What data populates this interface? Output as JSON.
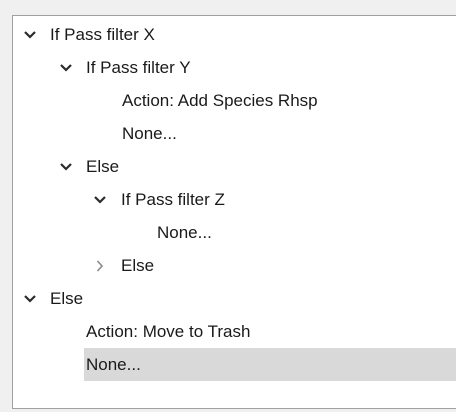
{
  "tree": {
    "nodes": [
      {
        "label": "If Pass filter X",
        "expanded": true,
        "chevron": "chevron-down-icon"
      },
      {
        "label": "If Pass filter Y",
        "expanded": true,
        "chevron": "chevron-down-icon"
      },
      {
        "label": "Action: Add Species Rhsp"
      },
      {
        "label": "None..."
      },
      {
        "label": "Else",
        "expanded": true,
        "chevron": "chevron-down-icon"
      },
      {
        "label": "If Pass filter Z",
        "expanded": true,
        "chevron": "chevron-down-icon"
      },
      {
        "label": "None..."
      },
      {
        "label": "Else",
        "expanded": false,
        "chevron": "chevron-right-icon"
      },
      {
        "label": "Else",
        "expanded": true,
        "chevron": "chevron-down-icon"
      },
      {
        "label": "Action: Move to Trash"
      },
      {
        "label": "None...",
        "selected": true
      }
    ]
  },
  "colors": {
    "selection": "#d9d9d9",
    "chevron": "#2b2b2b",
    "chevron_collapsed": "#8a8a8a"
  }
}
